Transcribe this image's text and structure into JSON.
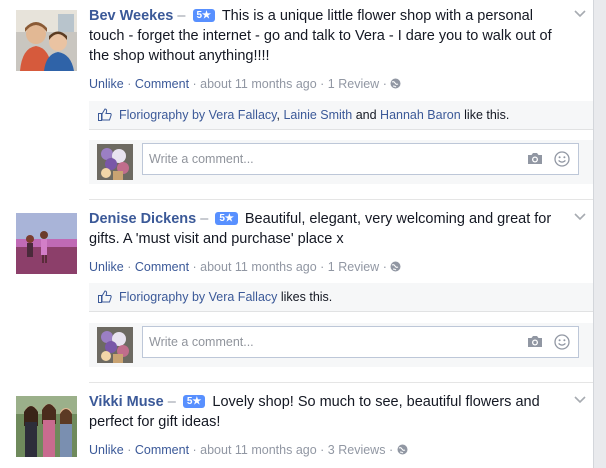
{
  "reviews": [
    {
      "name": "Bev Weekes",
      "dash": " – ",
      "rating": "5★",
      "text": "This is a unique little flower shop with a personal touch - forget the internet - go and talk to Vera - I dare you to walk out of the shop without anything!!!!",
      "unlike": "Unlike",
      "comment": "Comment",
      "time": "about 11 months ago",
      "review_count": "1 Review",
      "likers": [
        "Floriography by Vera Fallacy",
        "Lainie Smith",
        "Hannah Baron"
      ],
      "likes_sep": ", ",
      "likes_and": " and ",
      "likes_suffix": " like this.",
      "comment_placeholder": "Write a comment..."
    },
    {
      "name": "Denise Dickens",
      "dash": " – ",
      "rating": "5★",
      "text": "Beautiful, elegant, very welcoming and great for gifts. A 'must visit and purchase' place x",
      "unlike": "Unlike",
      "comment": "Comment",
      "time": "about 11 months ago",
      "review_count": "1 Review",
      "likers": [
        "Floriography by Vera Fallacy"
      ],
      "likes_suffix": " likes this.",
      "comment_placeholder": "Write a comment..."
    },
    {
      "name": "Vikki Muse",
      "dash": " – ",
      "rating": "5★",
      "text": "Lovely shop! So much to see, beautiful flowers and perfect for gift ideas!",
      "unlike": "Unlike",
      "comment": "Comment",
      "time": "about 11 months ago",
      "review_count": "3 Reviews"
    }
  ],
  "separator": " · ",
  "colors": {
    "link": "#3b5998",
    "meta": "#9197a3",
    "badge": "#5890ff",
    "bar": "#f6f7f8"
  }
}
